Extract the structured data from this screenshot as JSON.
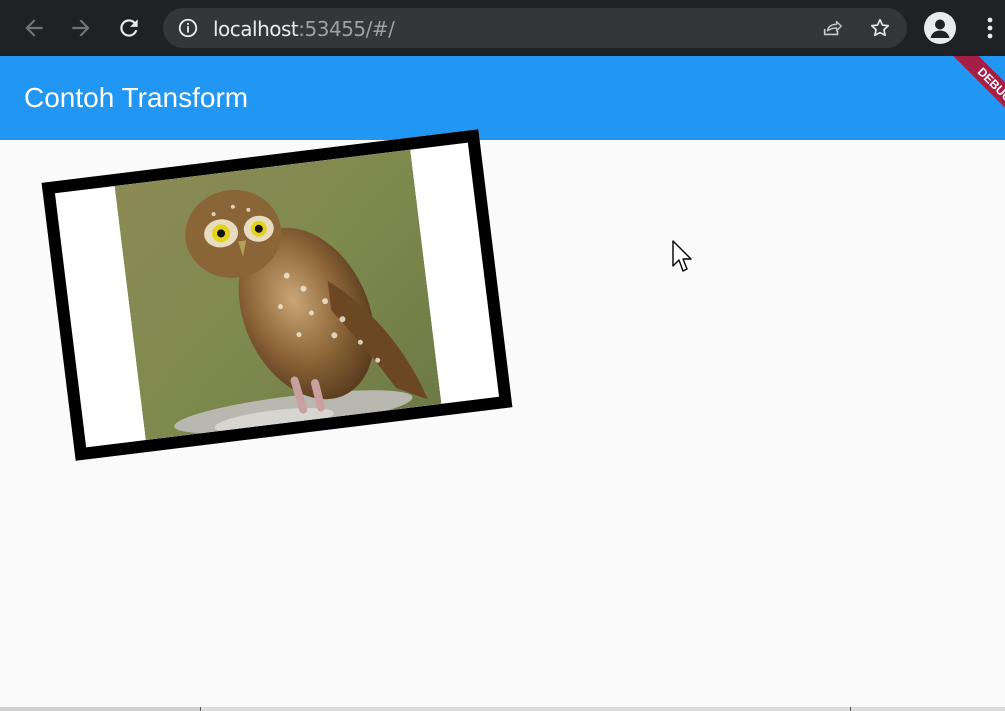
{
  "browser": {
    "url_host": "localhost",
    "url_rest": ":53455/#/"
  },
  "app": {
    "title": "Contoh Transform",
    "debug_banner": "DEBUG",
    "accent_color": "#2196f3",
    "banner_color": "#a51e45"
  },
  "icons": {
    "back": "arrow-left-icon",
    "forward": "arrow-right-icon",
    "reload": "reload-icon",
    "info": "info-icon",
    "share": "share-icon",
    "bookmark": "star-icon",
    "profile": "person-icon",
    "menu": "kebab-menu-icon"
  }
}
